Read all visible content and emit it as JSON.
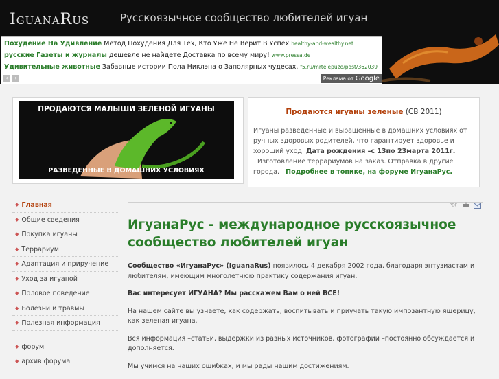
{
  "header": {
    "logo": "IguanaRus",
    "tagline": "Русскоязычное сообщество любителей игуан"
  },
  "ads": {
    "items": [
      {
        "title": "Похудение На Удивление",
        "text": "Метод Похудения Для Тех, Кто Уже Не Верит В Успех",
        "url": "healthy-and-wealthy.net"
      },
      {
        "title": "русские Газеты и журналы",
        "text": "дешевле не найдете Доставка по всему миру!",
        "url": "www.pressa.de"
      },
      {
        "title": "Удивительные животные",
        "text": "Забавные истории Пола Никлэна о Заполярных чудесах.",
        "url": "f5.ru/mrtelepuzo/post/362039"
      }
    ],
    "ads_by": "Реклама от",
    "ads_brand": "Google",
    "prev": "‹",
    "next": "›"
  },
  "promo": {
    "image_title": "ПРОДАЮТСЯ МАЛЫШИ ЗЕЛЕНОЙ ИГУАНЫ",
    "image_caption": "РАЗВЕДЕННЫЕ В ДОМАШНИХ УСЛОВИЯХ",
    "heading_main": "Продаются игуаны зеленые",
    "heading_note": "(СВ 2011)",
    "body_1": "Игуаны разведенные и выращенные в домашних условиях от ручных здоровых родителей, что гарантирует здоровье и хороший уход.",
    "date": "Дата рождения –с 13по 23марта 2011г.",
    "body_2": "Изготовление террариумов на заказ. Отправка в другие города.",
    "more": "Подробнее в топике, на форуме ИгуанаРус."
  },
  "menu": {
    "items": [
      {
        "label": "Главная",
        "active": true
      },
      {
        "label": "Общие сведения"
      },
      {
        "label": "Покупка игуаны"
      },
      {
        "label": "Террариум"
      },
      {
        "label": "Адаптация и приручение"
      },
      {
        "label": "Уход за игуаной"
      },
      {
        "label": "Половое поведение"
      },
      {
        "label": "Болезни и травмы"
      },
      {
        "label": "Полезная информация"
      }
    ],
    "items2": [
      {
        "label": "форум"
      },
      {
        "label": "архив форума"
      }
    ]
  },
  "main": {
    "pdf_label": "PDF",
    "title": "ИгуанаРус - международное русскоязычное сообщество любителей игуан",
    "p1_prefix": "Сообщество «ИгуанаРус» (IguanaRus)",
    "p1_rest": " появилось 4 декабря 2002 года, благодаря энтузиастам и любителям, имеющим многолетнюю практику содержания игуан.",
    "p2": "Вас интересует ИГУАНА? Мы расскажем Вам о ней ВСЕ!",
    "p3": "На нашем сайте вы узнаете, как содержать, воспитывать и приучать такую импозантную ящерицу, как зеленая игуана.",
    "p4": "Вся информация –статьи, выдержки из разных источников, фотографии –постоянно обсуждается и дополняется.",
    "p5": "Мы учимся на наших ошибках, и мы рады нашим достижениям."
  }
}
